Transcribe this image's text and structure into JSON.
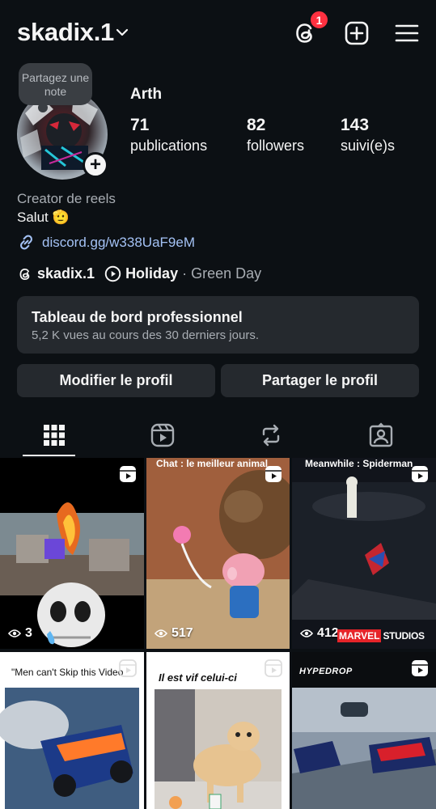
{
  "header": {
    "username": "skadix.1",
    "threads_badge": "1",
    "icons": [
      "threads-icon",
      "create-icon",
      "menu-icon"
    ]
  },
  "profile": {
    "note_text": "Partagez une note",
    "display_name": "Arth",
    "stats": [
      {
        "value": "71",
        "label": "publications"
      },
      {
        "value": "82",
        "label": "followers"
      },
      {
        "value": "143",
        "label": "suivi(e)s"
      }
    ],
    "category": "Creator de reels",
    "bio": "Salut 🫡",
    "link": "discord.gg/w338UaF9eM",
    "threads_handle": "skadix.1",
    "music_title": "Holiday",
    "music_artist": "· Green Day"
  },
  "dashboard": {
    "title": "Tableau de bord professionnel",
    "subtitle": "5,2 K vues au cours des 30 derniers jours."
  },
  "buttons": {
    "edit": "Modifier le profil",
    "share": "Partager le profil"
  },
  "tabs": [
    "grid-icon",
    "reels-icon",
    "reposts-icon",
    "tagged-icon"
  ],
  "grid": [
    {
      "views": "3",
      "caption": ""
    },
    {
      "views": "517",
      "caption": "Chat : le meilleur animal"
    },
    {
      "views": "412",
      "caption": "Meanwhile : Spiderman",
      "logo_a": "MARVEL",
      "logo_b": "STUDIOS"
    },
    {
      "views": "",
      "caption": "\"Men can't Skip this Video"
    },
    {
      "views": "",
      "caption": "Il est vif celui-ci"
    },
    {
      "views": "",
      "caption": "HYPEDROP"
    }
  ],
  "colors": {
    "background": "#0c1014",
    "card": "#25292e",
    "link": "#a4c2f5",
    "badge": "#ff3040"
  }
}
